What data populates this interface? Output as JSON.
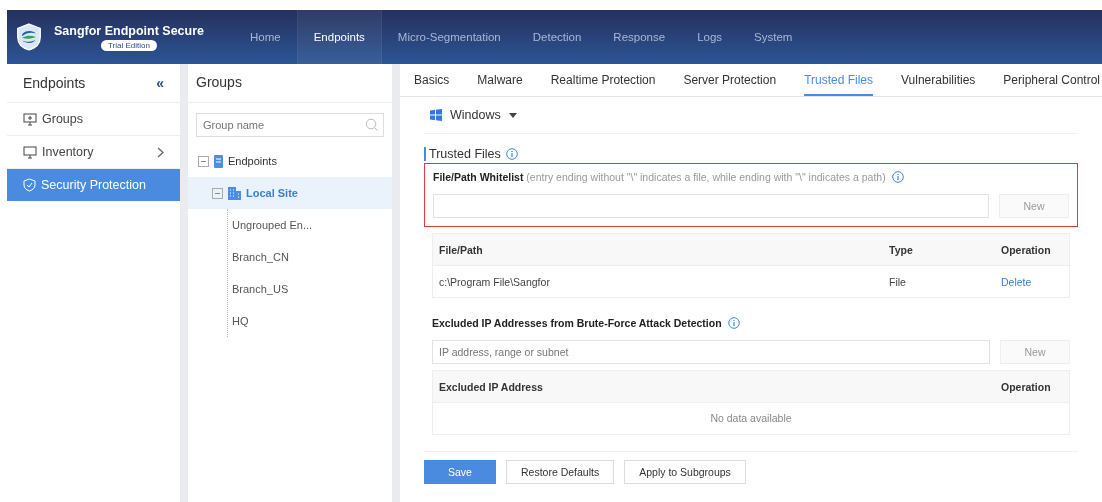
{
  "header": {
    "product": "Sangfor Endpoint Secure",
    "edition": "Trial Edition",
    "nav": [
      {
        "label": "Home",
        "selected": false
      },
      {
        "label": "Endpoints",
        "selected": true
      },
      {
        "label": "Micro-Segmentation",
        "selected": false
      },
      {
        "label": "Detection",
        "selected": false
      },
      {
        "label": "Response",
        "selected": false
      },
      {
        "label": "Logs",
        "selected": false
      },
      {
        "label": "System",
        "selected": false
      }
    ]
  },
  "sidebar": {
    "title": "Endpoints",
    "collapse": "«",
    "items": [
      {
        "label": "Groups",
        "expandable": false,
        "selected": false
      },
      {
        "label": "Inventory",
        "expandable": true,
        "selected": false
      },
      {
        "label": "Security Protection",
        "expandable": false,
        "selected": true
      }
    ]
  },
  "groups": {
    "title": "Groups",
    "search": {
      "placeholder": "Group name"
    },
    "tree": [
      {
        "label": "Endpoints",
        "expanded": true,
        "selected": false,
        "children": [
          {
            "label": "Local Site",
            "expanded": true,
            "selected": true,
            "children": [
              {
                "label": "Ungrouped En...",
                "selected": false
              },
              {
                "label": "Branch_CN",
                "selected": false
              },
              {
                "label": "Branch_US",
                "selected": false
              },
              {
                "label": "HQ",
                "selected": false
              }
            ]
          }
        ]
      }
    ]
  },
  "tabs": [
    {
      "label": "Basics",
      "selected": false
    },
    {
      "label": "Malware",
      "selected": false
    },
    {
      "label": "Realtime Protection",
      "selected": false
    },
    {
      "label": "Server Protection",
      "selected": false
    },
    {
      "label": "Trusted Files",
      "selected": true
    },
    {
      "label": "Vulnerabilities",
      "selected": false
    },
    {
      "label": "Peripheral Control",
      "selected": false
    }
  ],
  "os_selector": {
    "value": "Windows"
  },
  "section_title": "Trusted Files",
  "whitelist": {
    "label": "File/Path Whitelist",
    "hint": "(entry ending without \"\\\" indicates a file, while ending with \"\\\" indicates a path)",
    "highlighted": true,
    "button": {
      "label": "New",
      "disabled": true
    },
    "table": {
      "columns": [
        "File/Path",
        "Type",
        "Operation"
      ],
      "rows": [
        {
          "path": "c:\\Program File\\Sangfor",
          "type": "File",
          "action": "Delete"
        }
      ]
    }
  },
  "excluded_ips": {
    "label": "Excluded IP Addresses from Brute-Force Attack Detection",
    "placeholder": "IP address, range or subnet",
    "button": {
      "label": "New",
      "disabled": true
    },
    "table": {
      "columns": [
        "Excluded IP Address",
        "Operation"
      ],
      "empty": "No data available"
    }
  },
  "footer_buttons": [
    {
      "label": "Save",
      "kind": "primary"
    },
    {
      "label": "Restore Defaults",
      "kind": "default"
    },
    {
      "label": "Apply to Subgroups",
      "kind": "default"
    }
  ]
}
